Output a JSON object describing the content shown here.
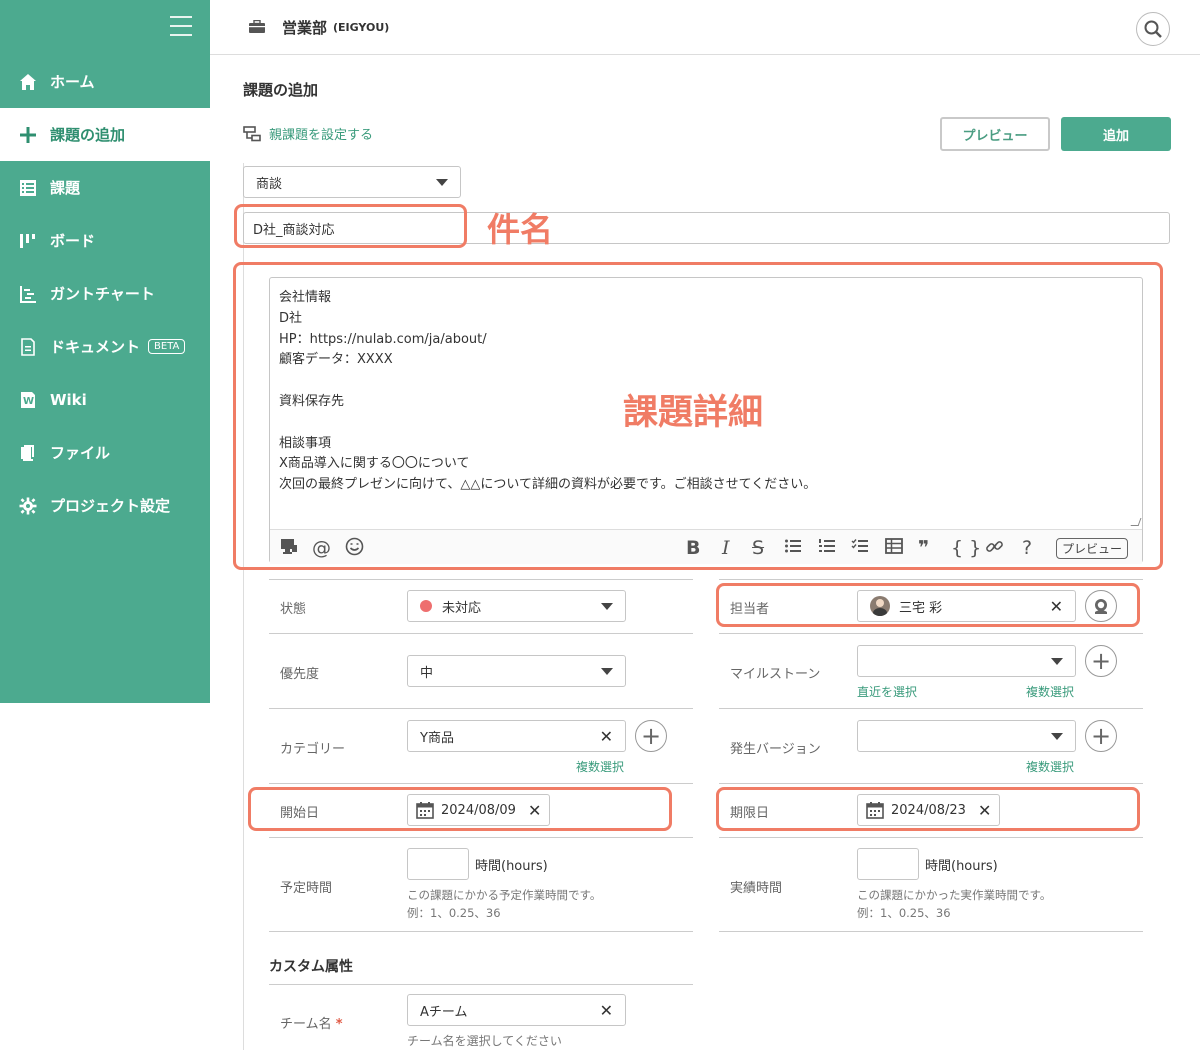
{
  "sidebar": {
    "items": [
      {
        "label": "ホーム",
        "icon": "home-icon"
      },
      {
        "label": "課題の追加",
        "icon": "plus-icon"
      },
      {
        "label": "課題",
        "icon": "list-icon"
      },
      {
        "label": "ボード",
        "icon": "board-icon"
      },
      {
        "label": "ガントチャート",
        "icon": "gantt-icon"
      },
      {
        "label": "ドキュメント",
        "icon": "document-icon",
        "badge": "BETA"
      },
      {
        "label": "Wiki",
        "icon": "wiki-icon"
      },
      {
        "label": "ファイル",
        "icon": "file-icon"
      },
      {
        "label": "プロジェクト設定",
        "icon": "gear-icon"
      }
    ],
    "active_index": 1
  },
  "header": {
    "project_name": "営業部",
    "project_key": "(EIGYOU)"
  },
  "page": {
    "title": "課題の追加",
    "parent_link": "親課題を設定する",
    "preview_button": "プレビュー",
    "add_button": "追加"
  },
  "issue_type": {
    "value": "商談"
  },
  "subject": {
    "value": "D社_商談対応"
  },
  "description": {
    "text": "会社情報\nD社\nHP：https://nulab.com/ja/about/\n顧客データ：XXXX\n\n資料保存先\n\n相談事項\nX商品導入に関する〇〇について\n次回の最終プレゼンに向けて、△△について詳細の資料が必要です。ご相談させてください。",
    "toolbar_preview": "プレビュー"
  },
  "annotations": {
    "subject": "件名",
    "description": "課題詳細"
  },
  "fields": {
    "status": {
      "label": "状態",
      "value": "未対応",
      "color": "#ee6f6f"
    },
    "assignee": {
      "label": "担当者",
      "value": "三宅 彩"
    },
    "priority": {
      "label": "優先度",
      "value": "中"
    },
    "milestone": {
      "label": "マイルストーン",
      "value": "",
      "link_recent": "直近を選択",
      "link_multi": "複数選択"
    },
    "category": {
      "label": "カテゴリー",
      "value": "Y商品",
      "link_multi": "複数選択"
    },
    "version": {
      "label": "発生バージョン",
      "value": "",
      "link_multi": "複数選択"
    },
    "start_date": {
      "label": "開始日",
      "value": "2024/08/09"
    },
    "due_date": {
      "label": "期限日",
      "value": "2024/08/23"
    },
    "estimated_hours": {
      "label": "予定時間",
      "unit": "時間(hours)",
      "hint1": "この課題にかかる予定作業時間です。",
      "hint2": "例：1、0.25、36"
    },
    "actual_hours": {
      "label": "実績時間",
      "unit": "時間(hours)",
      "hint1": "この課題にかかった実作業時間です。",
      "hint2": "例：1、0.25、36"
    }
  },
  "custom": {
    "section_title": "カスタム属性",
    "team_label": "チーム名",
    "required_mark": "*",
    "team_value": "Aチーム",
    "team_hint": "チーム名を選択してください"
  },
  "colors": {
    "brand": "#4caa8f",
    "highlight": "#f07c65"
  }
}
